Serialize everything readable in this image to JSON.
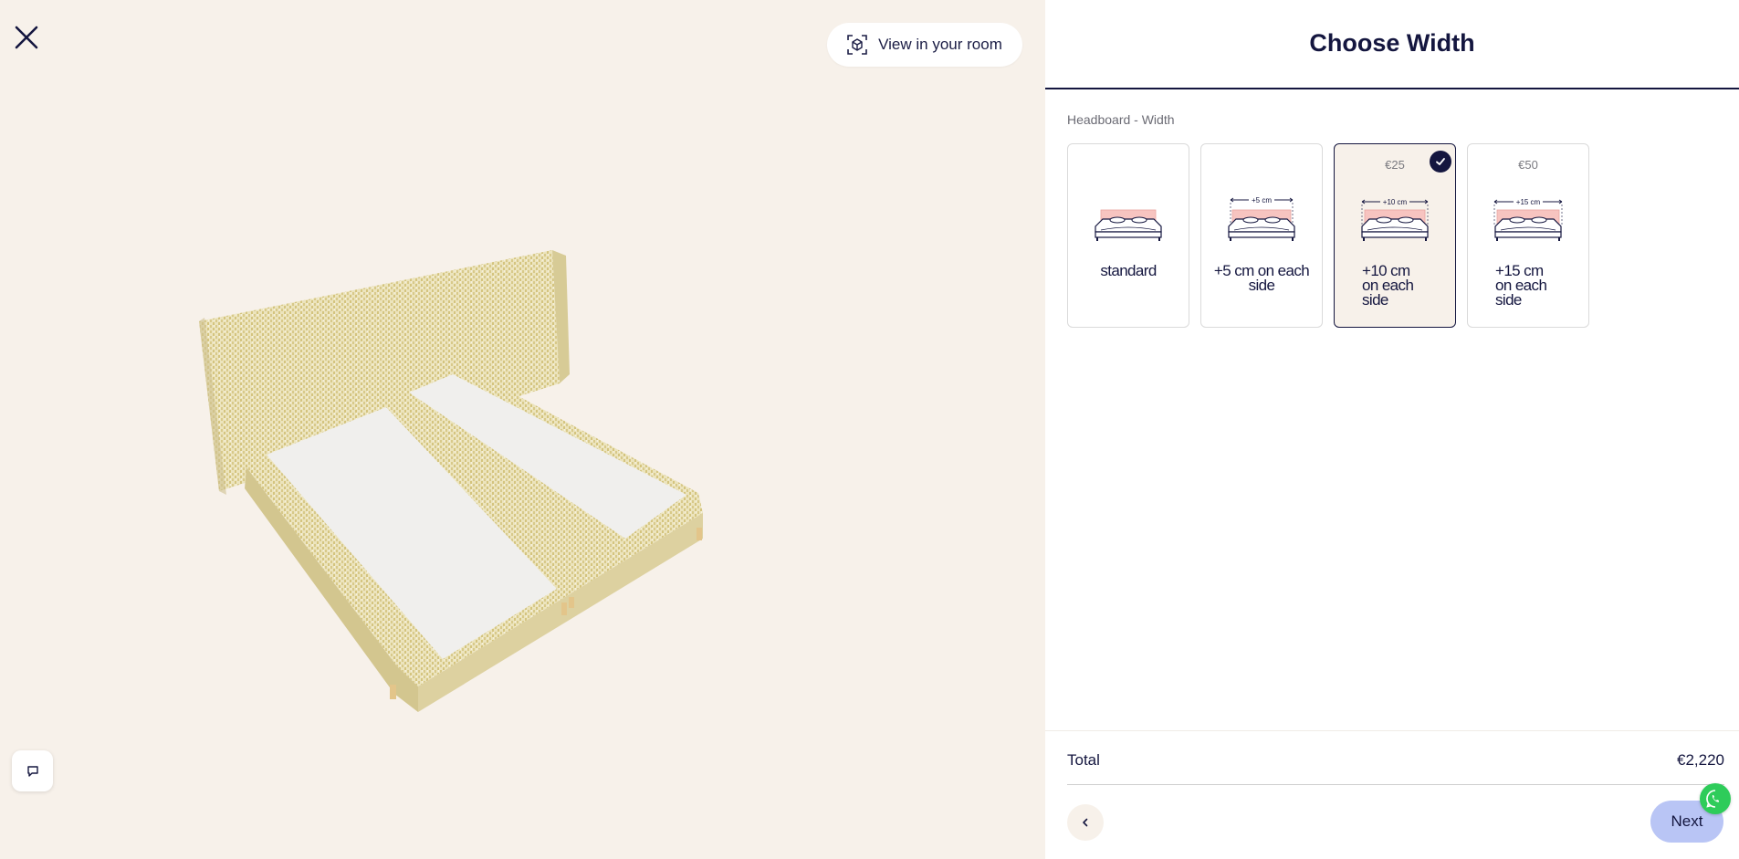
{
  "viewer": {
    "view_room_label": "View in your room"
  },
  "panel": {
    "title": "Choose Width",
    "section_label": "Headboard - Width",
    "options": [
      {
        "price": "",
        "dimension": "",
        "label": "standard",
        "selected": false
      },
      {
        "price": "",
        "dimension": "+5 cm",
        "label": "+5 cm on each side",
        "selected": false
      },
      {
        "price": "€25",
        "dimension": "+10 cm",
        "label": "+10 cm on each side",
        "selected": true
      },
      {
        "price": "€50",
        "dimension": "+15 cm",
        "label": "+15 cm on each side",
        "selected": false
      }
    ]
  },
  "footer": {
    "total_label": "Total",
    "total_value": "€2,220",
    "next_label": "Next"
  },
  "colors": {
    "navy": "#14163f",
    "cream": "#f7f1ea",
    "headboard_pink": "#f5b8b4",
    "next_button": "#b9c5f5",
    "whatsapp": "#2ecc5a",
    "fabric": "#e6dcae"
  },
  "icons": {
    "close": "close-icon",
    "view_room": "ar-cube-icon",
    "chat": "chat-icon",
    "check": "check-icon",
    "back": "chevron-left-icon",
    "whatsapp": "whatsapp-icon"
  }
}
